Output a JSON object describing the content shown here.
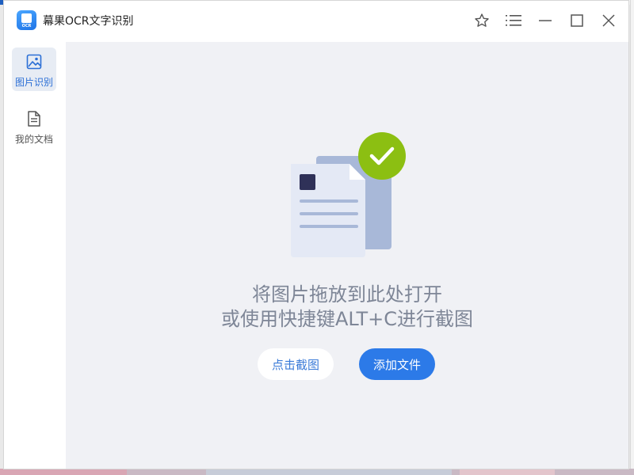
{
  "window": {
    "title": "幕果OCR文字识别",
    "logo_text": "OCR"
  },
  "titlebar_icons": [
    "star-icon",
    "menu-icon",
    "minimize-icon",
    "maximize-icon",
    "close-icon"
  ],
  "sidebar": {
    "items": [
      {
        "label": "图片识别",
        "icon": "image-icon",
        "active": true
      },
      {
        "label": "我的文档",
        "icon": "document-icon",
        "active": false
      }
    ]
  },
  "main": {
    "hint_line1": "将图片拖放到此处打开",
    "hint_line2": "或使用快捷键ALT+C进行截图",
    "capture_button": "点击截图",
    "add_file_button": "添加文件"
  },
  "colors": {
    "accent": "#2c7ae8",
    "check_green": "#8cbf12",
    "content_bg": "#f0f1f5"
  }
}
